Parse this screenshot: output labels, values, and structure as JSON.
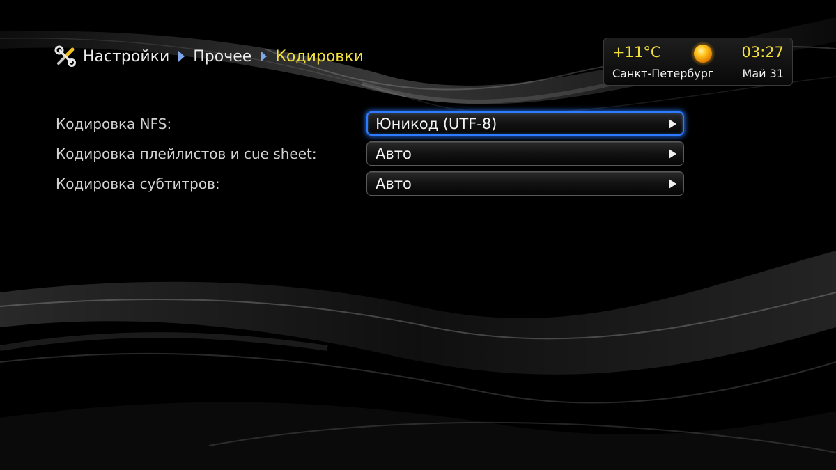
{
  "breadcrumb": {
    "icon": "tools-icon",
    "items": [
      "Настройки",
      "Прочее",
      "Кодировки"
    ]
  },
  "status": {
    "temperature": "+11°C",
    "weather_icon": "sun-icon",
    "time": "03:27",
    "city": "Санкт-Петербург",
    "date": "Май 31"
  },
  "settings": [
    {
      "label": "Кодировка NFS:",
      "value": "Юникод (UTF-8)",
      "focused": true
    },
    {
      "label": "Кодировка плейлистов и cue sheet:",
      "value": "Авто",
      "focused": false
    },
    {
      "label": "Кодировка субтитров:",
      "value": "Авто",
      "focused": false
    }
  ],
  "colors": {
    "accent_yellow": "#f4e03a",
    "focus_blue": "#2f7bff",
    "breadcrumb_arrow": "#7fa6e6",
    "background": "#000000"
  }
}
